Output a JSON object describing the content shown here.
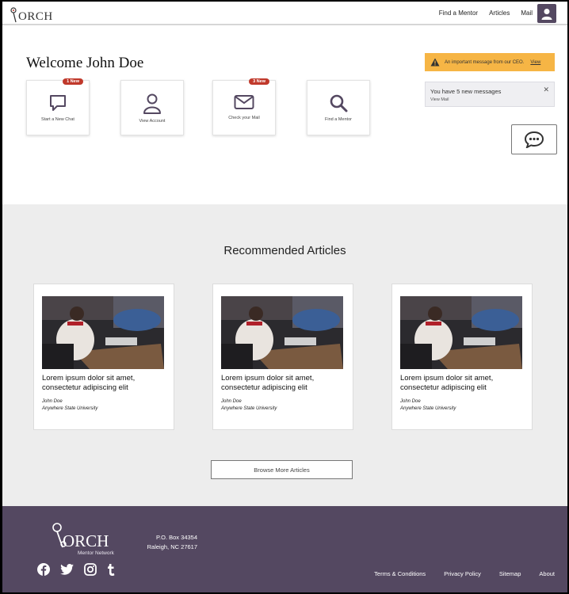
{
  "header": {
    "logo_text": "ORCH",
    "nav": [
      "Find a Mentor",
      "Articles",
      "Mail"
    ]
  },
  "welcome": "Welcome John Doe",
  "tiles": [
    {
      "label": "Start a New Chat",
      "badge": "1 New",
      "icon": "chat-bubble-icon"
    },
    {
      "label": "View Account",
      "badge": "",
      "icon": "user-icon"
    },
    {
      "label": "Check your Mail",
      "badge": "3 New",
      "icon": "mail-icon"
    },
    {
      "label": "Find a Mentor",
      "badge": "",
      "icon": "search-icon"
    }
  ],
  "alert": {
    "text": "An important message from our CEO.",
    "link": "View",
    "color": "#f6b545"
  },
  "messages": {
    "text": "You have 5 new messages",
    "link": "View Mail",
    "close": "✕"
  },
  "articles": {
    "title": "Recommended Articles",
    "cards": [
      {
        "title": "Lorem ipsum dolor sit amet, consectetur adipiscing elit",
        "author": "John Doe",
        "org": "Anywhere State University"
      },
      {
        "title": "Lorem ipsum dolor sit amet, consectetur adipiscing elit",
        "author": "John Doe",
        "org": "Anywhere State University"
      },
      {
        "title": "Lorem ipsum dolor sit amet, consectetur adipiscing elit",
        "author": "John Doe",
        "org": "Anywhere State University"
      }
    ],
    "browse": "Browse More Articles"
  },
  "footer": {
    "logo_text": "ORCH",
    "logo_sub": "Mentor Network",
    "address": [
      "P.O. Box 34354",
      "Raleigh, NC 27617"
    ],
    "social": [
      "facebook-icon",
      "twitter-icon",
      "instagram-icon",
      "tumblr-icon"
    ],
    "links": [
      "Terms & Conditions",
      "Privacy Policy",
      "Sitemap",
      "About"
    ]
  },
  "colors": {
    "brand": "#544861",
    "alert": "#f6b545",
    "badge": "#c0392b",
    "section_bg": "#ededed"
  }
}
